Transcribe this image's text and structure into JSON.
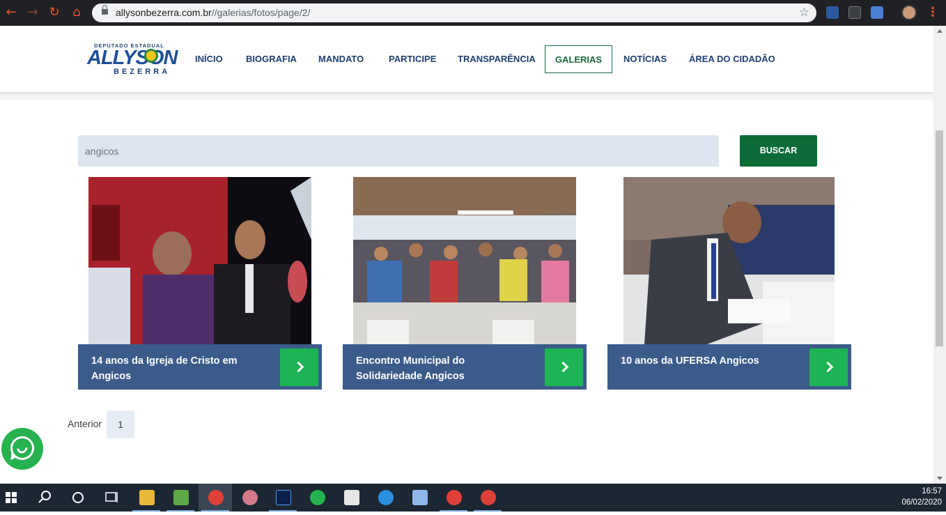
{
  "browser": {
    "url_host": "allysonbezerra.com.br",
    "url_path": "//galerias/fotos/page/2/"
  },
  "site": {
    "logo": {
      "top": "DEPUTADO ESTADUAL",
      "name": "ALLYSON",
      "surname": "BEZERRA"
    },
    "menu": [
      "INÍCIO",
      "BIOGRAFIA",
      "MANDATO",
      "PARTICIPE",
      "TRANSPARÊNCIA",
      "GALERIAS",
      "NOTÍCIAS",
      "ÁREA DO CIDADÃO"
    ],
    "active_menu": "GALERIAS"
  },
  "search": {
    "value": "angicos",
    "button_label": "BUSCAR"
  },
  "gallery": [
    {
      "title": "14 anos da Igreja de Cristo em Angicos"
    },
    {
      "title": "Encontro Municipal do Solidariedade Angicos"
    },
    {
      "title": "10 anos da UFERSA Angicos"
    }
  ],
  "pagination": {
    "prev_label": "Anterior",
    "current": "1"
  },
  "taskbar": {
    "time": "16:57",
    "date": "06/02/2020"
  },
  "colors": {
    "nav_blue": "#1f3f73",
    "brand_green": "#0d6b37",
    "caption_blue": "#3b5b8a",
    "arrow_green": "#1cb454"
  }
}
